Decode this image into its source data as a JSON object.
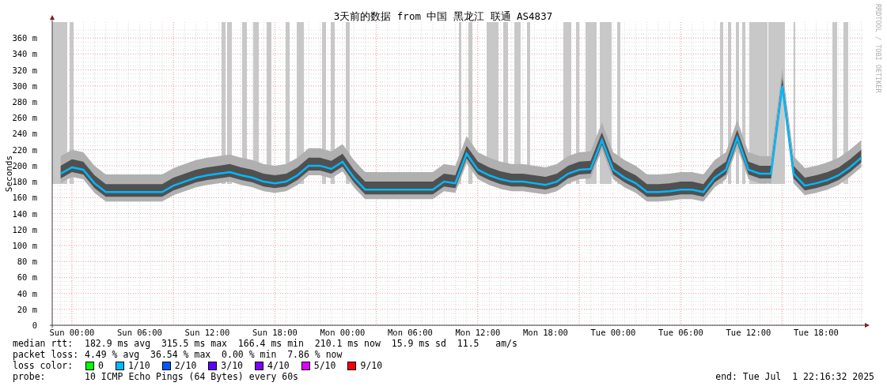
{
  "chart_data": {
    "type": "line",
    "title": "3天前的数据 from 中国 黑龙江 联通 AS4837",
    "ylabel": "Seconds",
    "ylim": [
      0,
      380
    ],
    "grid": true,
    "categories": [
      null,
      "Sun 00:00",
      null,
      null,
      null,
      null,
      null,
      "Sun 06:00",
      null,
      null,
      null,
      null,
      null,
      "Sun 12:00",
      null,
      null,
      null,
      null,
      null,
      "Sun 18:00",
      null,
      null,
      null,
      null,
      null,
      "Mon 00:00",
      null,
      null,
      null,
      null,
      null,
      "Mon 06:00",
      null,
      null,
      null,
      null,
      null,
      "Mon 12:00",
      null,
      null,
      null,
      null,
      null,
      "Mon 18:00",
      null,
      null,
      null,
      null,
      null,
      "Tue 00:00",
      null,
      null,
      null,
      null,
      null,
      "Tue 06:00",
      null,
      null,
      null,
      null,
      null,
      "Tue 12:00",
      null,
      null,
      null,
      null,
      null,
      "Tue 18:00",
      null,
      null,
      null,
      null
    ],
    "series": [
      {
        "color": "#00b8ff",
        "values": [
          190,
          198,
          195,
          178,
          167,
          167,
          167,
          167,
          167,
          167,
          175,
          180,
          185,
          188,
          190,
          192,
          188,
          185,
          180,
          178,
          180,
          188,
          200,
          200,
          196,
          205,
          185,
          170,
          170,
          170,
          170,
          170,
          170,
          170,
          180,
          178,
          215,
          195,
          188,
          183,
          180,
          180,
          178,
          176,
          180,
          190,
          195,
          196,
          232,
          195,
          185,
          178,
          167,
          167,
          168,
          170,
          170,
          167,
          185,
          195,
          235,
          195,
          190,
          190,
          300,
          190,
          175,
          178,
          182,
          188,
          198,
          210
        ]
      }
    ],
    "yticks": [
      {
        "value": 0,
        "label": "0"
      },
      {
        "value": 20,
        "label": "20 m"
      },
      {
        "value": 40,
        "label": "40 m"
      },
      {
        "value": 60,
        "label": "60 m"
      },
      {
        "value": 80,
        "label": "80 m"
      },
      {
        "value": 100,
        "label": "100 m"
      },
      {
        "value": 120,
        "label": "120 m"
      },
      {
        "value": 140,
        "label": "140 m"
      },
      {
        "value": 160,
        "label": "160 m"
      },
      {
        "value": 180,
        "label": "180 m"
      },
      {
        "value": 200,
        "label": "200 m"
      },
      {
        "value": 220,
        "label": "220 m"
      },
      {
        "value": 240,
        "label": "240 m"
      },
      {
        "value": 260,
        "label": "260 m"
      },
      {
        "value": 280,
        "label": "280 m"
      },
      {
        "value": 300,
        "label": "300 m"
      },
      {
        "value": 320,
        "label": "320 m"
      },
      {
        "value": 340,
        "label": "340 m"
      },
      {
        "value": 360,
        "label": "360 m"
      }
    ]
  },
  "watermark_text": "RRDTOOL / TOBI OETIKER",
  "stats": [
    {
      "label": "median rtt:",
      "text": "182.9 ms avg  315.5 ms max  166.4 ms min  210.1 ms now  15.9 ms sd  11.5   am/s"
    },
    {
      "label": "packet loss:",
      "text": "4.49 % avg  36.54 % max  0.00 % min  7.86 % now"
    }
  ],
  "loss_colors": {
    "label": "loss color:",
    "items": [
      {
        "label": "0",
        "color": "#00ff00"
      },
      {
        "label": "1/10",
        "color": "#00b8ff"
      },
      {
        "label": "2/10",
        "color": "#0059ff"
      },
      {
        "label": "3/10",
        "color": "#5e00ff"
      },
      {
        "label": "4/10",
        "color": "#7e00ff"
      },
      {
        "label": "5/10",
        "color": "#dd00ff"
      },
      {
        "label": "9/10",
        "color": "#ff0000"
      }
    ]
  },
  "probe": {
    "label": "probe:",
    "text": "10 ICMP Echo Pings (64 Bytes) every 60s"
  },
  "end": "end: Tue Jul  1 22:16:32 2025"
}
